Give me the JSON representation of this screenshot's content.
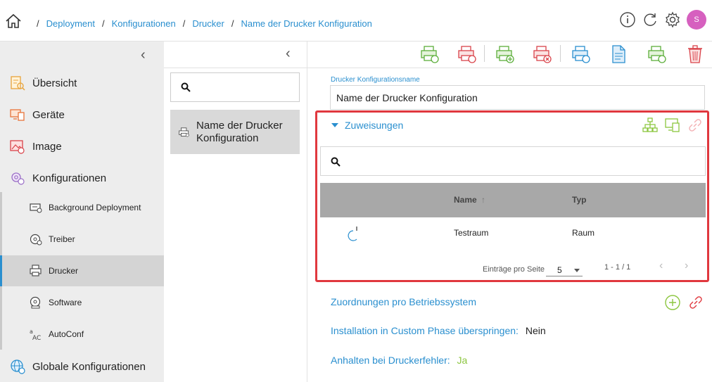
{
  "header": {
    "breadcrumb": [
      "Deployment",
      "Konfigurationen",
      "Drucker",
      "Name der Drucker Konfiguration"
    ],
    "separator": "/",
    "avatar_initial": "S",
    "accent_color": "#2a8fcf"
  },
  "sidebar": {
    "main_items": [
      {
        "label": "Übersicht",
        "icon": "overview-icon"
      },
      {
        "label": "Geräte",
        "icon": "devices-icon"
      },
      {
        "label": "Image",
        "icon": "image-icon"
      },
      {
        "label": "Konfigurationen",
        "icon": "configurations-icon"
      }
    ],
    "sub_items": [
      {
        "label": "Background Deployment",
        "icon": "background-deployment-icon",
        "active": false
      },
      {
        "label": "Treiber",
        "icon": "driver-icon",
        "active": false
      },
      {
        "label": "Drucker",
        "icon": "printer-icon",
        "active": true
      },
      {
        "label": "Software",
        "icon": "software-icon",
        "active": false
      },
      {
        "label": "AutoConf",
        "icon": "autoconf-icon",
        "active": false
      }
    ],
    "bottom_item": {
      "label": "Globale Konfigurationen",
      "icon": "globe-icon"
    }
  },
  "list": {
    "items": [
      {
        "label": "Name der Drucker Konfiguration",
        "selected": true
      }
    ]
  },
  "form": {
    "name_label": "Drucker Konfigurationsname",
    "name_value": "Name der Drucker Konfiguration",
    "assignments": {
      "title": "Zuweisungen",
      "columns": {
        "name": "Name",
        "sort_indicator": "↑",
        "type": "Typ"
      },
      "rows": [
        {
          "name": "Testraum",
          "type": "Raum"
        }
      ],
      "pager": {
        "label": "Einträge pro Seite",
        "page_size": "5",
        "range": "1 - 1 / 1"
      }
    },
    "os_label": "Zuordnungen pro Betriebssystem",
    "skip_custom_phase": {
      "label": "Installation in Custom Phase überspringen:",
      "value": "Nein"
    },
    "halt_on_error": {
      "label": "Anhalten bei Druckerfehler:",
      "value": "Ja",
      "value_color": "#8cc63f"
    }
  }
}
